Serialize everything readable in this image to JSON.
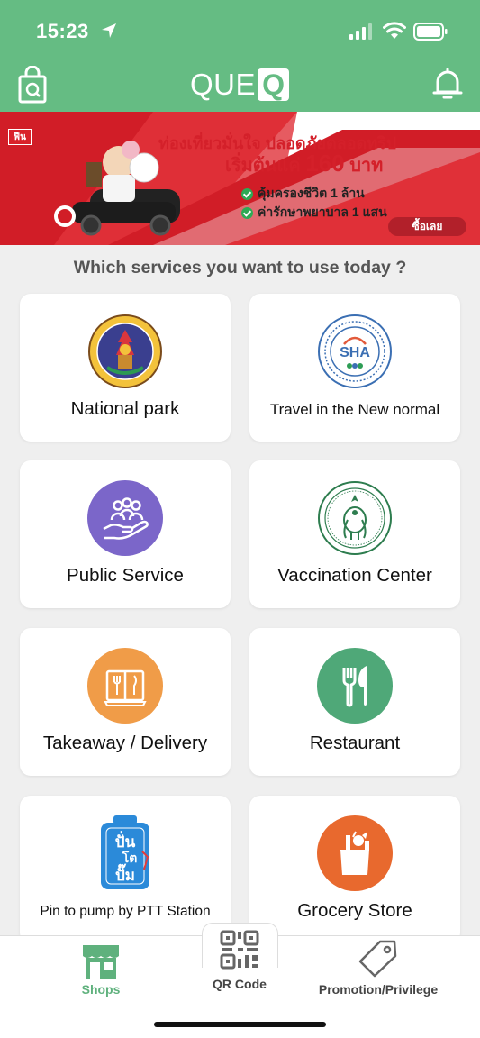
{
  "status_bar": {
    "time": "15:23"
  },
  "header": {
    "logo_text": "QUE",
    "logo_box": "Q"
  },
  "banner": {
    "tag": "ฟีน",
    "line1": "ท่องเที่ยวมั่นใจ ปลอดภัยตลอดทริป",
    "line2_prefix": "เริ่มต้นแค่",
    "line2_price": "160",
    "line2_suffix": "บาท",
    "bullet1": "คุ้มครองชีวิต 1 ล้าน",
    "bullet2": "ค่ารักษาพยาบาล 1 แสน",
    "button": "ซื้อเลย"
  },
  "question": "Which services you want to use today ?",
  "services": [
    {
      "label": "National park"
    },
    {
      "label": "Travel in the New normal"
    },
    {
      "label": "Public Service"
    },
    {
      "label": "Vaccination Center"
    },
    {
      "label": "Takeaway / Delivery"
    },
    {
      "label": "Restaurant"
    },
    {
      "label": "Pin to pump by PTT Station",
      "logo_line1": "ปั่น",
      "logo_line2": "โต",
      "logo_line3": "ปั๊ม"
    },
    {
      "label": "Grocery Store"
    }
  ],
  "sha_logo": {
    "text": "SHA"
  },
  "tabs": [
    {
      "label": "Shops"
    },
    {
      "label": "QR Code"
    },
    {
      "label": "Promotion/Privilege"
    }
  ],
  "colors": {
    "brand_green": "#65bc83",
    "purple": "#7b66c9",
    "orange": "#f09c48",
    "green_icon": "#4fa878",
    "grocery_orange": "#e8692e"
  }
}
